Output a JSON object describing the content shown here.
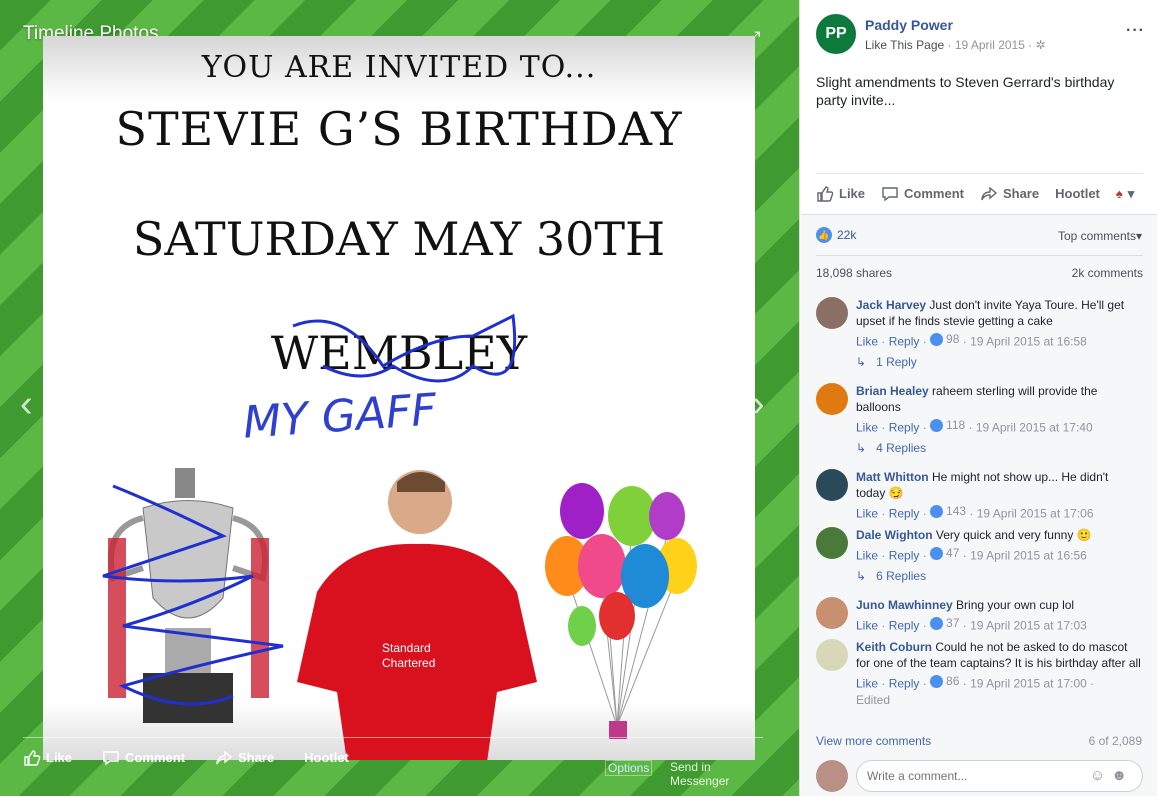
{
  "viewer": {
    "title": "Timeline Photos",
    "photo": {
      "line1": "YOU ARE INVITED TO...",
      "line2": "STEVIE G’S BIRTHDAY",
      "line3": "SATURDAY MAY 30TH",
      "line4": "WEMBLEY",
      "handwritten": "MY GAFF"
    },
    "bottom_actions": {
      "like": "Like",
      "comment": "Comment",
      "share": "Share",
      "hootlet": "Hootlet",
      "options": "Options",
      "messenger": "Send in Messenger"
    }
  },
  "post": {
    "page_name": "Paddy Power",
    "avatar_text": "PP",
    "like_page": "Like This Page",
    "date": "19 April 2015",
    "text": "Slight amendments to Steven Gerrard's birthday party invite...",
    "actions": {
      "like": "Like",
      "comment": "Comment",
      "share": "Share",
      "hootlet": "Hootlet"
    },
    "reactions": "22k",
    "sort": "Top comments",
    "shares": "18,098 shares",
    "comments_count": "2k comments"
  },
  "comments": [
    {
      "name": "Jack Harvey",
      "text": "Just don't invite Yaya Toure. He'll get upset if he finds stevie getting a cake",
      "likes": "98",
      "time": "19 April 2015 at 16:58",
      "replies": "1 Reply"
    },
    {
      "name": "Brian Healey",
      "text": "raheem sterling will provide the balloons",
      "likes": "118",
      "time": "19 April 2015 at 17:40",
      "replies": "4 Replies"
    },
    {
      "name": "Matt Whitton",
      "text": "He might not show up... He didn't today 😏",
      "likes": "143",
      "time": "19 April 2015 at 17:06"
    },
    {
      "name": "Dale Wighton",
      "text": "Very quick and very funny 🙂",
      "likes": "47",
      "time": "19 April 2015 at 16:56",
      "replies": "6 Replies"
    },
    {
      "name": "Juno Mawhinney",
      "text": "Bring your own cup lol",
      "likes": "37",
      "time": "19 April 2015 at 17:03"
    },
    {
      "name": "Keith Coburn",
      "text": "Could he not be asked to do mascot for one of the team captains? It is his birthday after all",
      "likes": "86",
      "time": "19 April 2015 at 17:00",
      "edited": "Edited"
    }
  ],
  "comment_labels": {
    "like": "Like",
    "reply": "Reply"
  },
  "view_more": "View more comments",
  "count_of": "6 of 2,089",
  "composer_placeholder": "Write a comment...",
  "colors": {
    "accent": "#365899",
    "like_blue": "#4b8ff0",
    "viewer_green": "#4ea83a"
  }
}
